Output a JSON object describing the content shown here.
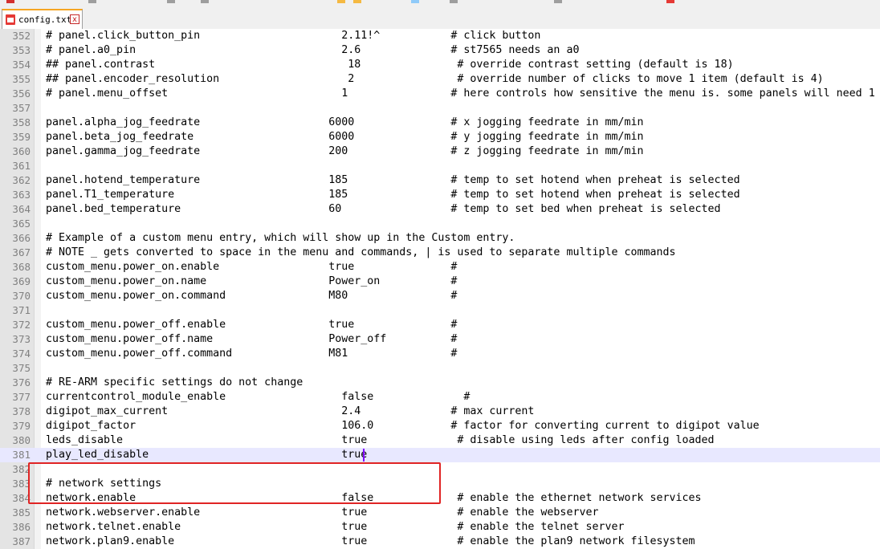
{
  "tab": {
    "label": "config.txt",
    "close_glyph": "x",
    "icon": "file-icon"
  },
  "editor": {
    "current_line": 381,
    "lines": [
      {
        "n": "352",
        "text": "# panel.click_button_pin                      2.11!^           # click button"
      },
      {
        "n": "353",
        "text": "# panel.a0_pin                                2.6              # st7565 needs an a0"
      },
      {
        "n": "354",
        "text": "## panel.contrast                              18               # override contrast setting (default is 18)"
      },
      {
        "n": "355",
        "text": "## panel.encoder_resolution                    2                # override number of clicks to move 1 item (default is 4)"
      },
      {
        "n": "356",
        "text": "# panel.menu_offset                           1                # here controls how sensitive the menu is. some panels will need 1"
      },
      {
        "n": "357",
        "text": ""
      },
      {
        "n": "358",
        "text": "panel.alpha_jog_feedrate                    6000               # x jogging feedrate in mm/min"
      },
      {
        "n": "359",
        "text": "panel.beta_jog_feedrate                     6000               # y jogging feedrate in mm/min"
      },
      {
        "n": "360",
        "text": "panel.gamma_jog_feedrate                    200                # z jogging feedrate in mm/min"
      },
      {
        "n": "361",
        "text": ""
      },
      {
        "n": "362",
        "text": "panel.hotend_temperature                    185                # temp to set hotend when preheat is selected"
      },
      {
        "n": "363",
        "text": "panel.T1_temperature                        185                # temp to set hotend when preheat is selected"
      },
      {
        "n": "364",
        "text": "panel.bed_temperature                       60                 # temp to set bed when preheat is selected"
      },
      {
        "n": "365",
        "text": ""
      },
      {
        "n": "366",
        "text": "# Example of a custom menu entry, which will show up in the Custom entry."
      },
      {
        "n": "367",
        "text": "# NOTE _ gets converted to space in the menu and commands, | is used to separate multiple commands"
      },
      {
        "n": "368",
        "text": "custom_menu.power_on.enable                 true               #"
      },
      {
        "n": "369",
        "text": "custom_menu.power_on.name                   Power_on           #"
      },
      {
        "n": "370",
        "text": "custom_menu.power_on.command                M80                #"
      },
      {
        "n": "371",
        "text": ""
      },
      {
        "n": "372",
        "text": "custom_menu.power_off.enable                true               #"
      },
      {
        "n": "373",
        "text": "custom_menu.power_off.name                  Power_off          #"
      },
      {
        "n": "374",
        "text": "custom_menu.power_off.command               M81                #"
      },
      {
        "n": "375",
        "text": ""
      },
      {
        "n": "376",
        "text": "# RE-ARM specific settings do not change"
      },
      {
        "n": "377",
        "text": "currentcontrol_module_enable                  false              #"
      },
      {
        "n": "378",
        "text": "digipot_max_current                           2.4              # max current"
      },
      {
        "n": "379",
        "text": "digipot_factor                                106.0            # factor for converting current to digipot value"
      },
      {
        "n": "380",
        "text": "leds_disable                                  true              # disable using leds after config loaded"
      },
      {
        "n": "381",
        "text": "play_led_disable                              true"
      },
      {
        "n": "382",
        "text": ""
      },
      {
        "n": "383",
        "text": "# network settings"
      },
      {
        "n": "384",
        "text": "network.enable                                false             # enable the ethernet network services"
      },
      {
        "n": "385",
        "text": "network.webserver.enable                      true              # enable the webserver"
      },
      {
        "n": "386",
        "text": "network.telnet.enable                         true              # enable the telnet server"
      },
      {
        "n": "387",
        "text": "network.plan9.enable                          true              # enable the plan9 network filesystem"
      }
    ]
  },
  "colors": {
    "highlight_box": "#e02424",
    "current_line": "#e8e8ff",
    "caret": "#8000ff",
    "gutter": "#e4e4e4"
  }
}
